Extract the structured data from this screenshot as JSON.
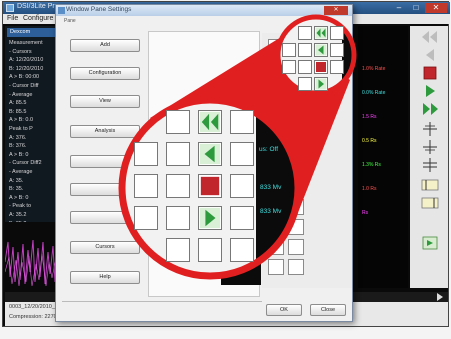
{
  "app": {
    "title": "DSI/3Lite Proc",
    "menu": {
      "file": "File",
      "configure": "Configure"
    },
    "window_controls": {
      "minimize": "–",
      "maximize": "□",
      "close": "✕"
    },
    "tree": {
      "header": "Dexcom",
      "lines": [
        "Measurement",
        "- Cursors",
        "  A: 12/20/2010",
        "  B: 12/20/2010",
        "  A > B: 00:00",
        "- Cursor Diff",
        "  - Average",
        "    A: 85.5",
        "    B: 85.5",
        "    A > B: 0.0",
        "  Peak to P",
        "    A: 376.",
        "    B: 376.",
        "    A > B: 0",
        "- Cursor Diff2",
        "  - Average",
        "    A: 35.",
        "    B: 35.",
        "    A > B: 0",
        "  - Peak to",
        "    A: 35.2",
        "    B: 35.2",
        "    A > B: 0"
      ]
    },
    "graph_labels": [
      {
        "text": "1.0% Rate",
        "color": "#ff5050"
      },
      {
        "text": "0.0% Rate",
        "color": "#40e0e0"
      },
      {
        "text": "1.5 Rs",
        "color": "#ff40ff"
      },
      {
        "text": "0.5 Rs",
        "color": "#ffff40"
      },
      {
        "text": "1.3% Rs",
        "color": "#40ff40"
      },
      {
        "text": "1.0 Rs",
        "color": "#ff5050"
      },
      {
        "text": "Rs",
        "color": "#ff40ff"
      }
    ],
    "status": {
      "line1": "0003_12/20/2010_13...",
      "line2": "Compression: 2270",
      "right": "0002"
    }
  },
  "dialog": {
    "title": "Window Pane Settings",
    "subtitle": "Pane",
    "side_buttons": [
      "Add",
      "Configuration",
      "View",
      "Analysis",
      "",
      "",
      "",
      "Cursors",
      "Help"
    ],
    "ok_label": "OK",
    "close_label": "Close"
  },
  "zoom": {
    "color_ring": "#e02020",
    "status_text": "us: Off",
    "value1": "833 Mv",
    "value2": "833 Mv",
    "value_color": "#40e0e0",
    "status_color": "#40e0e0"
  },
  "colors": {
    "arrow_green": "#2e9a3e",
    "stop_red": "#c0262c"
  }
}
